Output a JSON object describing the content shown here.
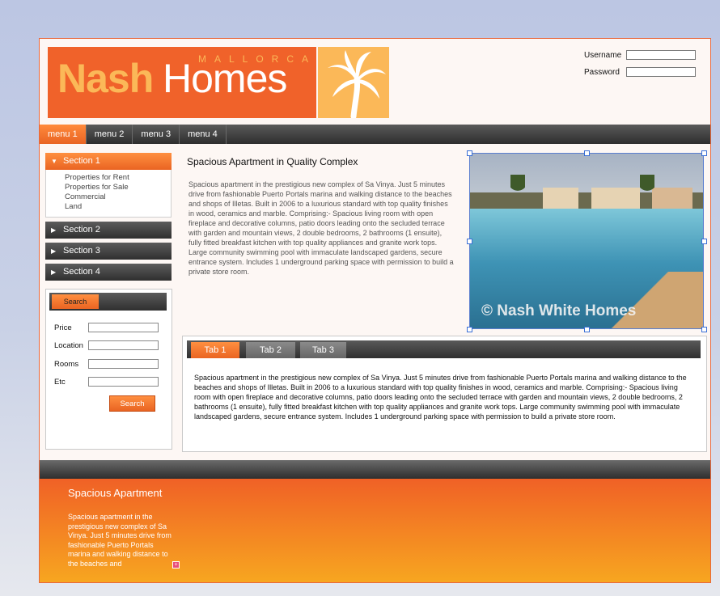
{
  "brand": {
    "nash": "Nash",
    "homes": "Homes",
    "region": "MALLORCA",
    "accent": "#f0622a",
    "accent_light": "#fbb858"
  },
  "login": {
    "username_label": "Username",
    "password_label": "Password"
  },
  "topnav": {
    "items": [
      "menu 1",
      "menu 2",
      "menu 3",
      "menu 4"
    ]
  },
  "sidebar": {
    "sections": [
      {
        "label": "Section 1",
        "items": [
          "Properties for Rent",
          "Properties for Sale",
          "Commercial",
          "Land"
        ]
      },
      {
        "label": "Section 2"
      },
      {
        "label": "Section 3"
      },
      {
        "label": "Section 4"
      }
    ]
  },
  "search": {
    "tab_label": "Search",
    "fields": [
      "Price",
      "Location",
      "Rooms",
      "Etc"
    ],
    "button_label": "Search"
  },
  "main": {
    "title": "Spacious Apartment in Quality Complex",
    "description": "Spacious apartment in the prestigious new complex of Sa Vinya. Just 5 minutes drive from fashionable Puerto Portals marina and walking distance to the beaches and shops of Illetas. Built in 2006 to a luxurious standard with top quality finishes in wood, ceramics and marble. Comprising:- Spacious living room with open fireplace and decorative columns, patio doors leading onto the secluded terrace with garden and mountain views, 2 double bedrooms, 2 bathrooms (1 ensuite), fully fitted breakfast kitchen with top quality appliances and granite work tops. Large community swimming pool with immaculate landscaped gardens, secure entrance system. Includes 1 underground parking space with permission to build a private store room.",
    "photo_watermark": "© Nash White Homes"
  },
  "tabs": {
    "labels": [
      "Tab 1",
      "Tab 2",
      "Tab 3"
    ],
    "content": "Spacious apartment in the prestigious new complex of Sa Vinya. Just 5 minutes drive from fashionable Puerto Portals marina and walking distance to the beaches and shops of Illetas. Built in 2006 to a luxurious standard with top quality finishes in wood, ceramics and marble. Comprising:- Spacious living room with open fireplace and decorative columns, patio doors leading onto the secluded terrace with garden and mountain views, 2 double bedrooms, 2 bathrooms (1 ensuite), fully fitted breakfast kitchen with top quality appliances and granite work tops. Large community swimming pool with immaculate landscaped gardens, secure entrance system. Includes 1 underground parking space with permission to build a private store room."
  },
  "footer": {
    "title": "Spacious Apartment",
    "text": "Spacious apartment in the prestigious new complex of Sa Vinya. Just 5 minutes drive from fashionable Puerto Portals marina and walking distance to the beaches and",
    "more_symbol": "+"
  }
}
